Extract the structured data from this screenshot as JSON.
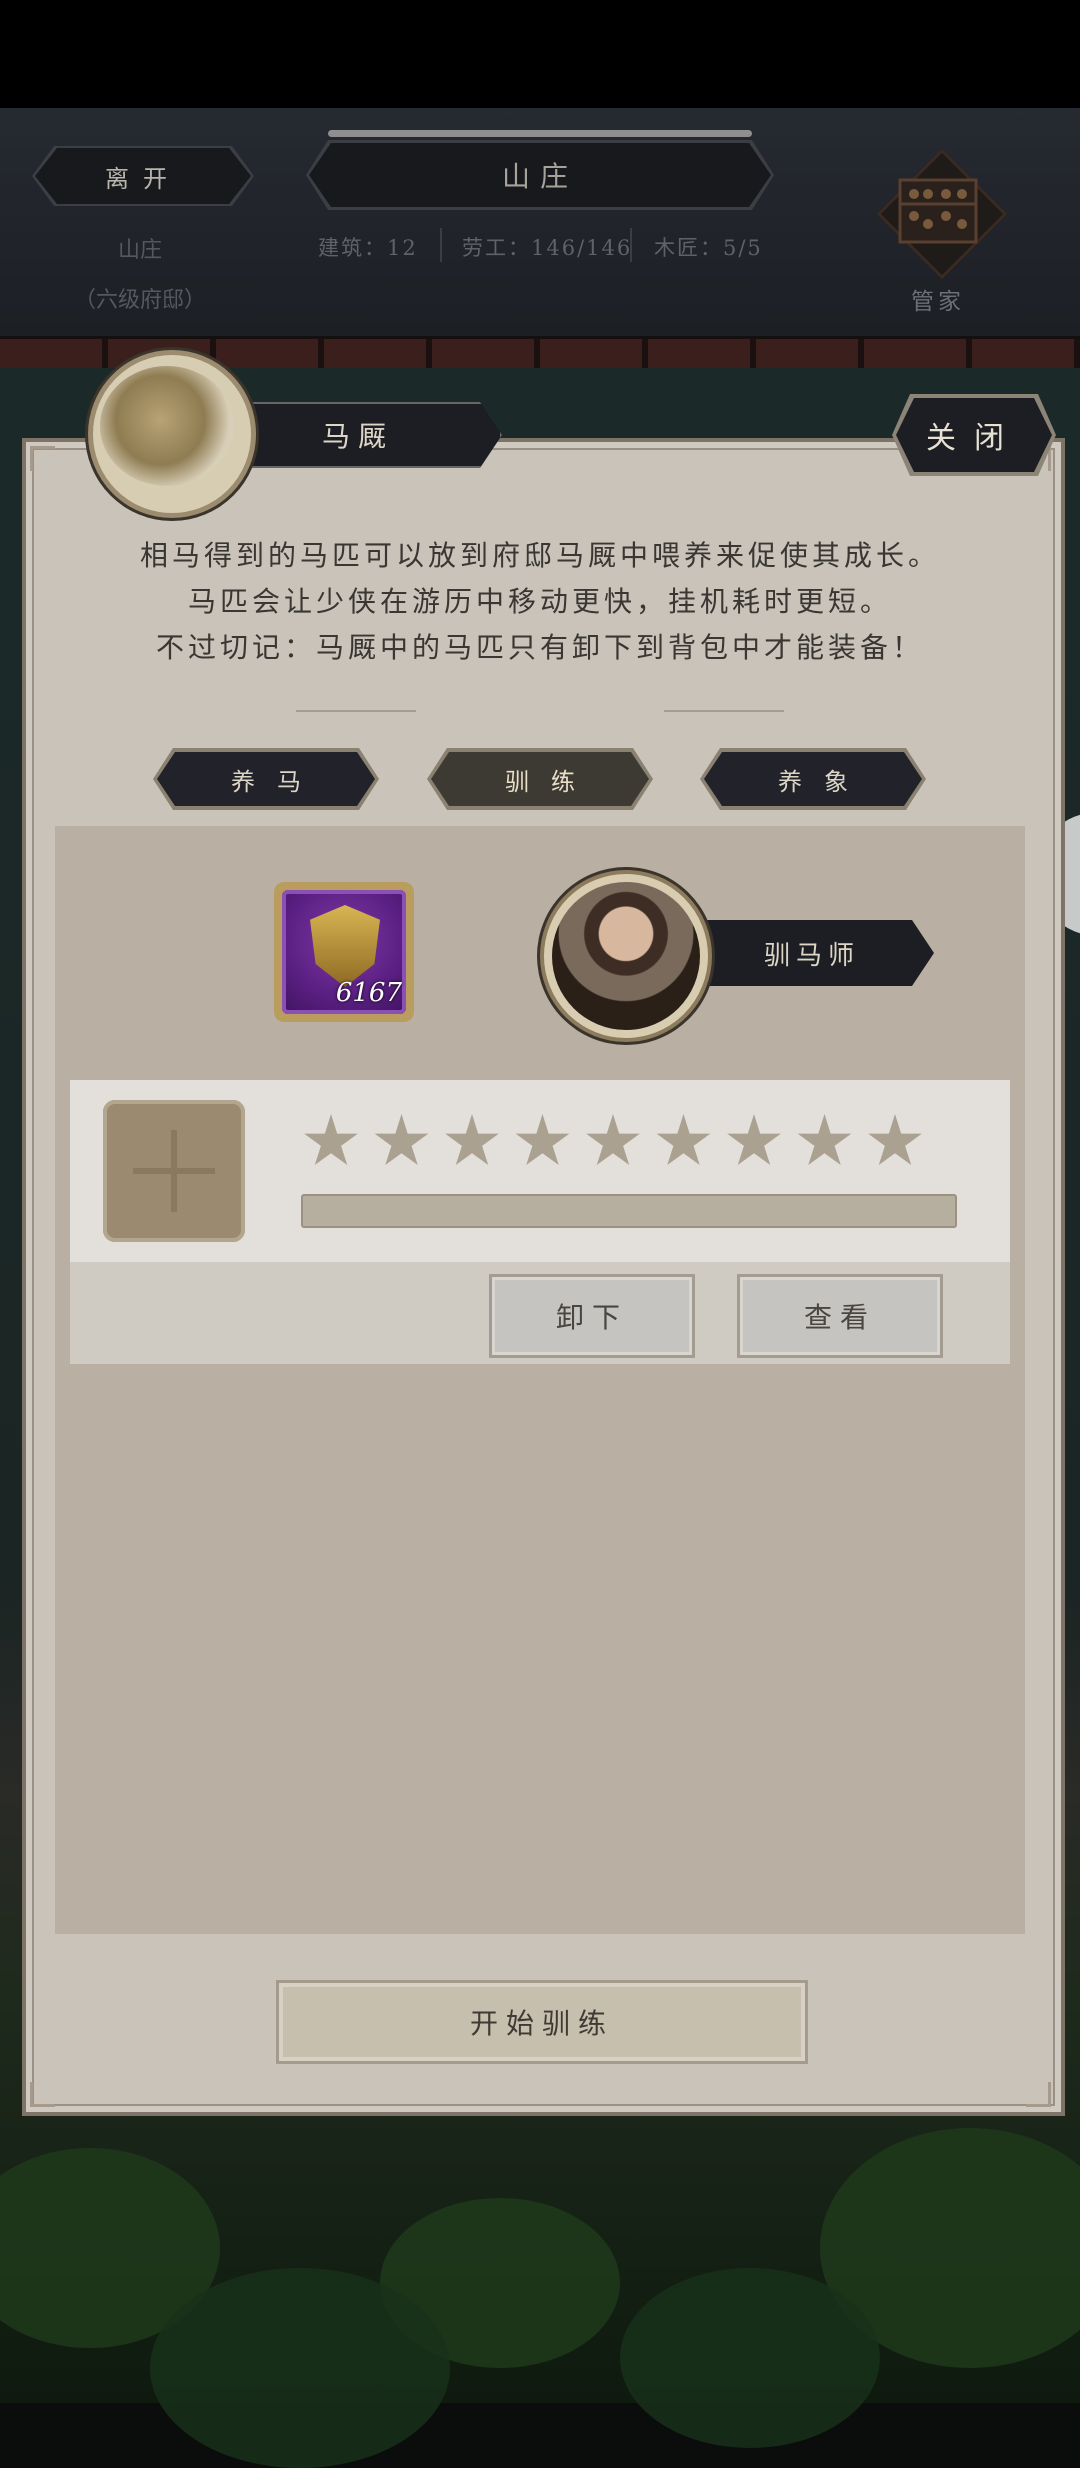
{
  "header": {
    "leave_label": "离开",
    "title": "山庄",
    "location_label": "山庄",
    "location_sub": "（六级府邸）",
    "stats": {
      "buildings": "建筑：12",
      "workers": "劳工：146/146",
      "carpenters": "木匠：5/5"
    },
    "butler_label": "管家"
  },
  "panel": {
    "tab_title": "马厩",
    "close_label": "关闭",
    "description": [
      "相马得到的马匹可以放到府邸马厩中喂养来促使其成长。",
      "马匹会让少侠在游历中移动更快，挂机耗时更短。",
      "不过切记：马厩中的马匹只有卸下到背包中才能装备！"
    ],
    "subtabs": [
      {
        "label": "养马",
        "active": false
      },
      {
        "label": "驯练",
        "active": true
      },
      {
        "label": "养象",
        "active": false
      }
    ],
    "item": {
      "count": "6167",
      "icon": "beast-badge-icon"
    },
    "trainer": {
      "name": "驯马师"
    },
    "horse": {
      "stars_total": 9,
      "stars_filled": 0,
      "progress": 0,
      "unload_label": "卸下",
      "view_label": "查看"
    },
    "start_label": "开始驯练"
  },
  "colors": {
    "panel_bg": "#c9c3ba",
    "content_bg": "#b9b0a3",
    "dark_button": "#1d1e23",
    "star_empty": "#aaa190",
    "item_purple": "#5a1f83"
  }
}
